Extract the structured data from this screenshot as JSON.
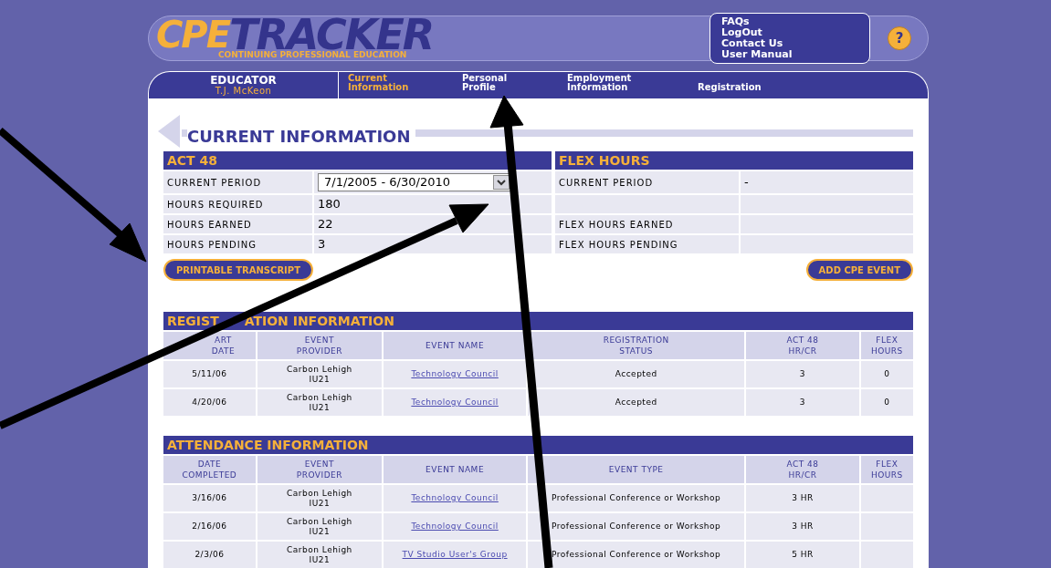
{
  "logo": {
    "part_1": "CPE",
    "part_2": "TRACKER",
    "tagline": "CONTINUING PROFESSIONAL EDUCATION"
  },
  "help_links": [
    "FAQs",
    "LogOut",
    "Contact Us",
    "User Manual"
  ],
  "help_button": "?",
  "user": {
    "role": "EDUCATOR",
    "name": "T.J. McKeon"
  },
  "nav_tabs": [
    {
      "label": "Current Information",
      "selected": true
    },
    {
      "label": "Personal Profile",
      "selected": false
    },
    {
      "label": "Employment Information",
      "selected": false
    },
    {
      "label": "Registration",
      "selected": false
    }
  ],
  "page_title": "CURRENT INFORMATION",
  "act48": {
    "title": "ACT 48",
    "period_label": "CURRENT PERIOD",
    "period_value": "7/1/2005 - 6/30/2010",
    "rows": [
      {
        "label": "HOURS REQUIRED",
        "value": "180"
      },
      {
        "label": "HOURS EARNED",
        "value": "22"
      },
      {
        "label": "HOURS PENDING",
        "value": "3"
      }
    ]
  },
  "flex_hours": {
    "title": "FLEX HOURS",
    "rows": [
      {
        "label": "CURRENT PERIOD",
        "value": "-"
      },
      {
        "label": "",
        "value": ""
      },
      {
        "label": "FLEX HOURS EARNED",
        "value": ""
      },
      {
        "label": "FLEX HOURS PENDING",
        "value": ""
      }
    ]
  },
  "buttons": [
    "PRINTABLE TRANSCRIPT",
    "ADD CPE EVENT"
  ],
  "registration": {
    "title_parts": [
      "REGIST",
      "ATION INFORMATION"
    ],
    "first_column_covered": true,
    "columns": [
      "ART DATE",
      "EVENT PROVIDER",
      "EVENT NAME",
      "REGISTRATION STATUS",
      "ACT 48 HR/CR",
      "FLEX HOURS"
    ],
    "rows": [
      [
        "5/11/06",
        "Carbon Lehigh IU21",
        "Technology Council",
        "Accepted",
        "3",
        "0"
      ],
      [
        "4/20/06",
        "Carbon Lehigh IU21",
        "Technology Council",
        "Accepted",
        "3",
        "0"
      ]
    ]
  },
  "attendance": {
    "title_parts": [
      "ATTENDANCE INFORMATION"
    ],
    "first_column_covered": false,
    "columns": [
      "DATE COMPLETED",
      "EVENT PROVIDER",
      "EVENT NAME",
      "EVENT TYPE",
      "ACT 48 HR/CR",
      "FLEX HOURS"
    ],
    "rows": [
      [
        "3/16/06",
        "Carbon Lehigh IU21",
        "Technology Council",
        "Professional Conference or Workshop",
        "3 HR",
        ""
      ],
      [
        "2/16/06",
        "Carbon Lehigh IU21",
        "Technology Council",
        "Professional Conference or Workshop",
        "3 HR",
        ""
      ],
      [
        "2/3/06",
        "Carbon Lehigh IU21",
        "TV Studio User's Group",
        "Professional Conference or Workshop",
        "5 HR",
        ""
      ]
    ]
  }
}
